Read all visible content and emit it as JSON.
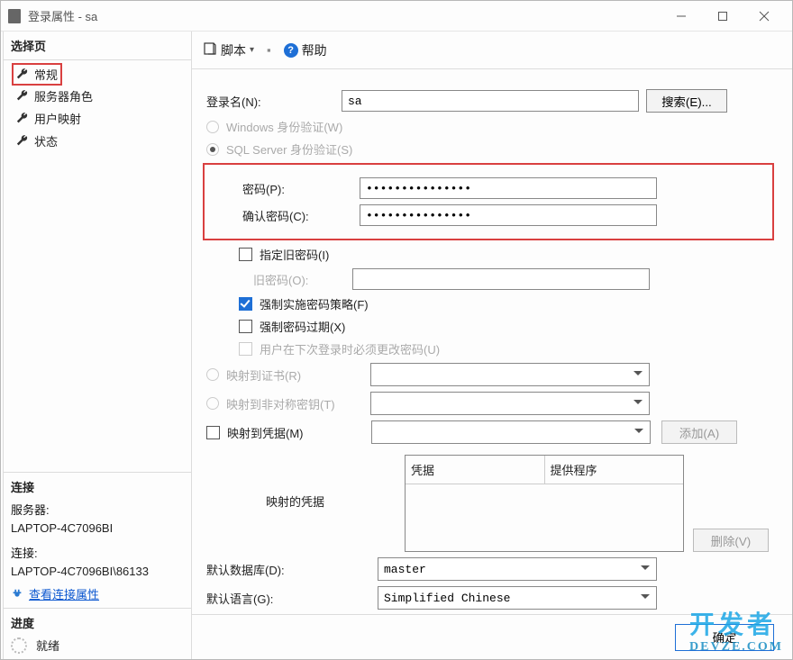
{
  "window": {
    "title": "登录属性 - sa"
  },
  "sidebar": {
    "select_page_title": "选择页",
    "items": [
      "常规",
      "服务器角色",
      "用户映射",
      "状态"
    ],
    "connection_title": "连接",
    "server_label": "服务器:",
    "server_value": "LAPTOP-4C7096BI",
    "conn_label": "连接:",
    "conn_value": "LAPTOP-4C7096BI\\86133",
    "view_conn_props": "查看连接属性",
    "progress_title": "进度",
    "progress_status": "就绪"
  },
  "toolbar": {
    "script_label": "脚本",
    "help_label": "帮助"
  },
  "form": {
    "login_name_label": "登录名(N):",
    "login_name_value": "sa",
    "search_btn": "搜索(E)...",
    "auth_windows": "Windows 身份验证(W)",
    "auth_sql": "SQL Server 身份验证(S)",
    "password_label": "密码(P):",
    "password_value": "•••••••••••••••",
    "confirm_label": "确认密码(C):",
    "confirm_value": "•••••••••••••••",
    "specify_old_pw": "指定旧密码(I)",
    "old_pw_label": "旧密码(O):",
    "enforce_policy": "强制实施密码策略(F)",
    "enforce_expire": "强制密码过期(X)",
    "must_change": "用户在下次登录时必须更改密码(U)",
    "map_cert": "映射到证书(R)",
    "map_asym": "映射到非对称密钥(T)",
    "map_cred": "映射到凭据(M)",
    "add_btn": "添加(A)",
    "mapped_cred_label": "映射的凭据",
    "col_cred": "凭据",
    "col_provider": "提供程序",
    "remove_btn": "删除(V)",
    "default_db_label": "默认数据库(D):",
    "default_db_value": "master",
    "default_lang_label": "默认语言(G):",
    "default_lang_value": "Simplified Chinese"
  },
  "footer": {
    "ok": "确定"
  },
  "watermark": {
    "main": "开发者",
    "sub": "DEVZE.COM"
  }
}
